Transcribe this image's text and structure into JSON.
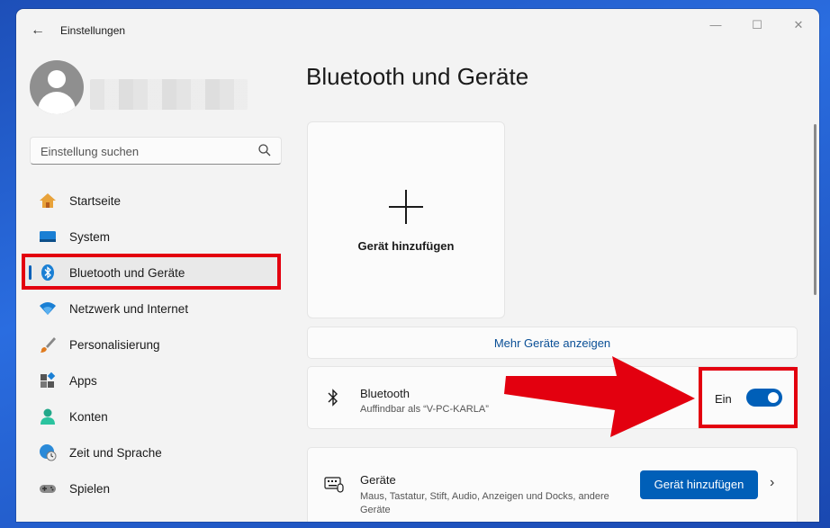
{
  "app": {
    "title": "Einstellungen"
  },
  "search": {
    "placeholder": "Einstellung suchen"
  },
  "sidebar": {
    "items": [
      {
        "label": "Startseite",
        "icon": "home-icon"
      },
      {
        "label": "System",
        "icon": "monitor-icon"
      },
      {
        "label": "Bluetooth und Geräte",
        "icon": "bluetooth-icon",
        "active": true
      },
      {
        "label": "Netzwerk und Internet",
        "icon": "wifi-icon"
      },
      {
        "label": "Personalisierung",
        "icon": "brush-icon"
      },
      {
        "label": "Apps",
        "icon": "apps-icon"
      },
      {
        "label": "Konten",
        "icon": "person-icon"
      },
      {
        "label": "Zeit und Sprache",
        "icon": "globe-clock-icon"
      },
      {
        "label": "Spielen",
        "icon": "gamepad-icon"
      }
    ]
  },
  "main": {
    "title": "Bluetooth und Geräte",
    "add_device_card": {
      "label": "Gerät hinzufügen"
    },
    "more_devices": {
      "label": "Mehr Geräte anzeigen"
    },
    "bluetooth": {
      "title": "Bluetooth",
      "subtitle": "Auffindbar als “V-PC-KARLA”",
      "state_label": "Ein",
      "enabled": true
    },
    "devices": {
      "title": "Geräte",
      "subtitle": "Maus, Tastatur, Stift, Audio, Anzeigen und Docks, andere Geräte",
      "button_label": "Gerät hinzufügen"
    }
  },
  "colors": {
    "accent": "#005fb8",
    "annotation": "#e3000f"
  }
}
